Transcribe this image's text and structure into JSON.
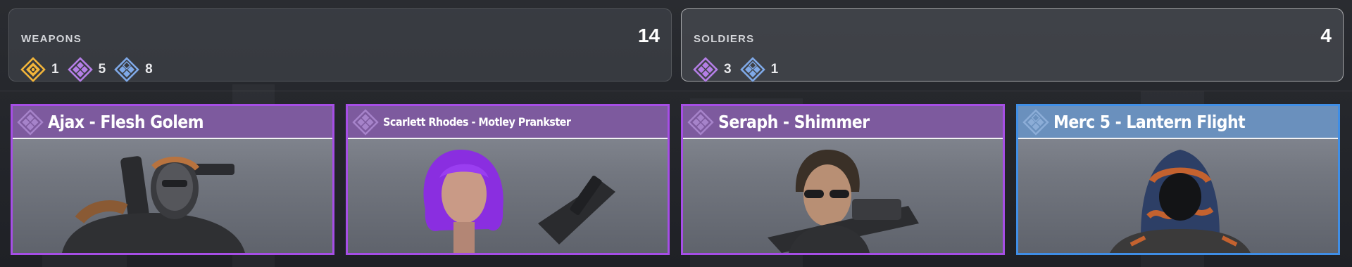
{
  "summary": {
    "weapons": {
      "title": "WEAPONS",
      "total": "14",
      "rarities": [
        {
          "icon": "legendary-rarity-icon",
          "color": "#f2b53a",
          "count": "1"
        },
        {
          "icon": "epic-rarity-icon",
          "color": "#b47ee6",
          "count": "5"
        },
        {
          "icon": "rare-rarity-icon",
          "color": "#7fa9e8",
          "count": "8"
        }
      ]
    },
    "soldiers": {
      "title": "SOLDIERS",
      "total": "4",
      "rarities": [
        {
          "icon": "epic-rarity-icon",
          "color": "#b47ee6",
          "count": "3"
        },
        {
          "icon": "rare-rarity-icon",
          "color": "#7fa9e8",
          "count": "1"
        }
      ]
    }
  },
  "cards": [
    {
      "name": "Ajax - Flesh Golem",
      "rarity": "epic",
      "border_color": "#a64ee6",
      "header_color": "#7d5a9e"
    },
    {
      "name": "Scarlett Rhodes - Motley Prankster",
      "rarity": "epic",
      "border_color": "#a64ee6",
      "header_color": "#7d5a9e"
    },
    {
      "name": "Seraph - Shimmer",
      "rarity": "epic",
      "border_color": "#a64ee6",
      "header_color": "#7d5a9e"
    },
    {
      "name": "Merc 5 - Lantern Flight",
      "rarity": "rare",
      "border_color": "#3f8ee6",
      "header_color": "#6a90bd"
    }
  ]
}
